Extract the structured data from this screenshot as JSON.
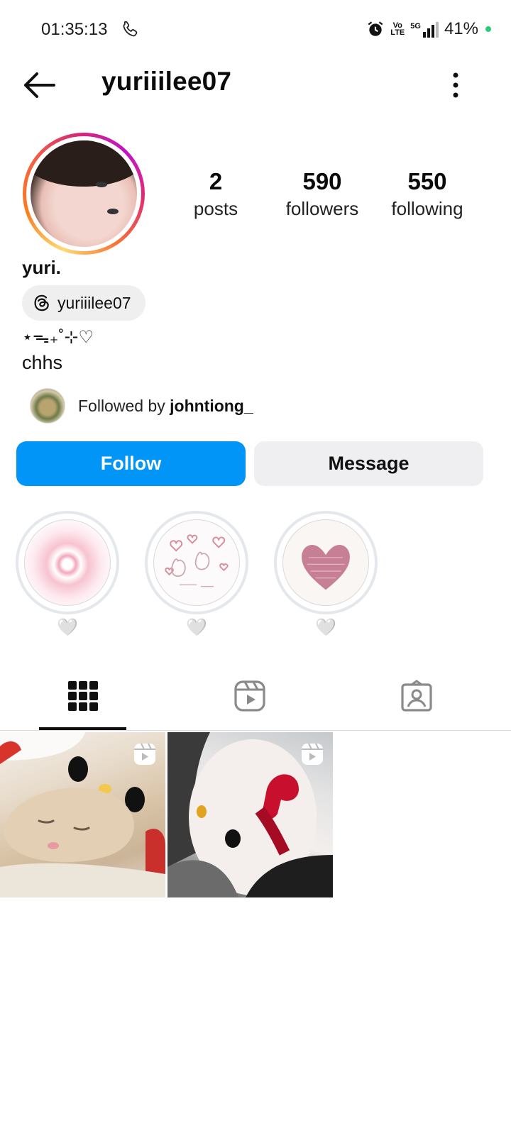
{
  "status_bar": {
    "time": "01:35:13",
    "battery": "41%",
    "network": "5G",
    "volte": "Vo LTE"
  },
  "header": {
    "username": "yuriiilee07"
  },
  "profile": {
    "display_name": "yuri.",
    "threads_handle": "yuriiilee07",
    "bio_line1": "⋆ᯓ₊˚⊹♡",
    "bio_line2": "chhs",
    "stats": {
      "posts_count": "2",
      "posts_label": "posts",
      "followers_count": "590",
      "followers_label": "followers",
      "following_count": "550",
      "following_label": "following"
    },
    "followed_by_prefix": "Followed by ",
    "followed_by_user": "johntiong_"
  },
  "actions": {
    "follow_label": "Follow",
    "message_label": "Message"
  },
  "highlights": [
    {
      "label": "🤍"
    },
    {
      "label": "🤍"
    },
    {
      "label": "🤍"
    }
  ],
  "tabs": [
    "grid-icon",
    "reels-icon",
    "tagged-icon"
  ],
  "colors": {
    "follow_button": "#0095f6",
    "message_button": "#efeff1",
    "status_dot": "#2ecc71"
  }
}
